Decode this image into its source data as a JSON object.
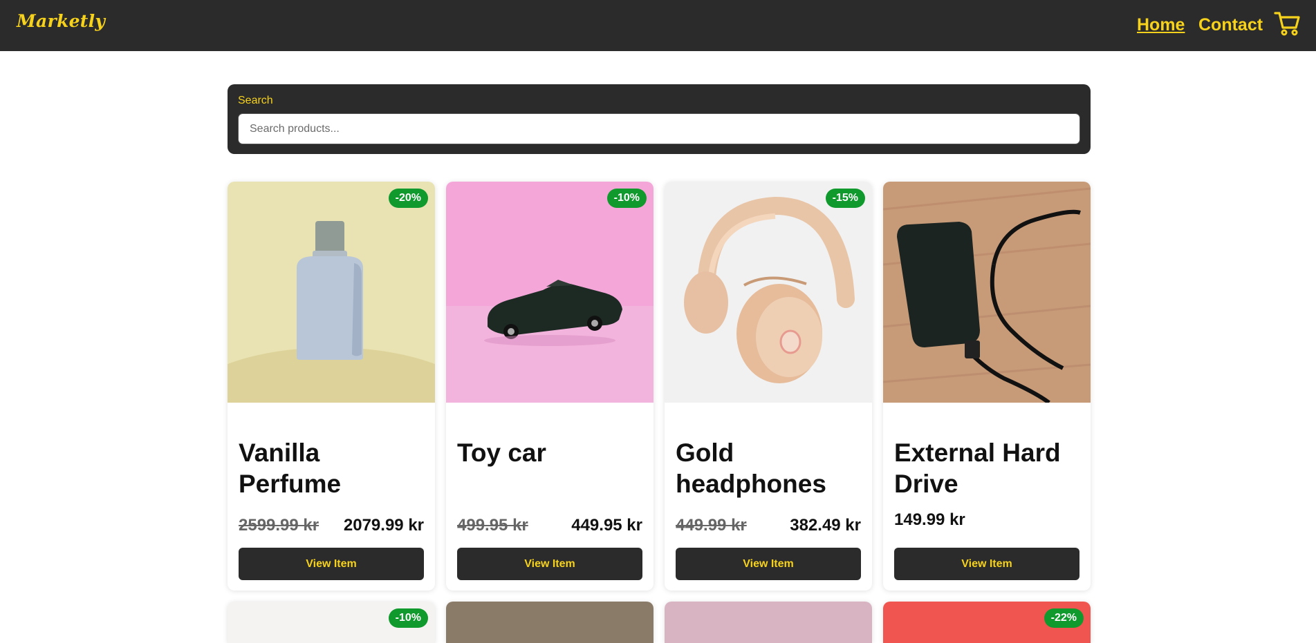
{
  "header": {
    "logo": "Marketly",
    "nav": {
      "home": "Home",
      "contact": "Contact"
    },
    "cart_icon": "cart-icon"
  },
  "search": {
    "label": "Search",
    "placeholder": "Search products...",
    "value": ""
  },
  "products": [
    {
      "title": "Vanilla Perfume",
      "discount": "-20%",
      "old_price": "2599.99 kr",
      "price": "2079.99 kr",
      "button": "View Item",
      "image": "perfume-bottle"
    },
    {
      "title": "Toy car",
      "discount": "-10%",
      "old_price": "499.95 kr",
      "price": "449.95 kr",
      "button": "View Item",
      "image": "toy-car"
    },
    {
      "title": "Gold headphones",
      "discount": "-15%",
      "old_price": "449.99 kr",
      "price": "382.49 kr",
      "button": "View Item",
      "image": "headphones"
    },
    {
      "title": "External Hard Drive",
      "discount": "",
      "old_price": "",
      "price": "149.99 kr",
      "button": "View Item",
      "image": "hard-drive"
    }
  ],
  "next_row_badges": [
    "-10%",
    "-22%"
  ],
  "colors": {
    "header_bg": "#2b2b2b",
    "accent": "#f7d21c",
    "badge": "#109a2e"
  }
}
